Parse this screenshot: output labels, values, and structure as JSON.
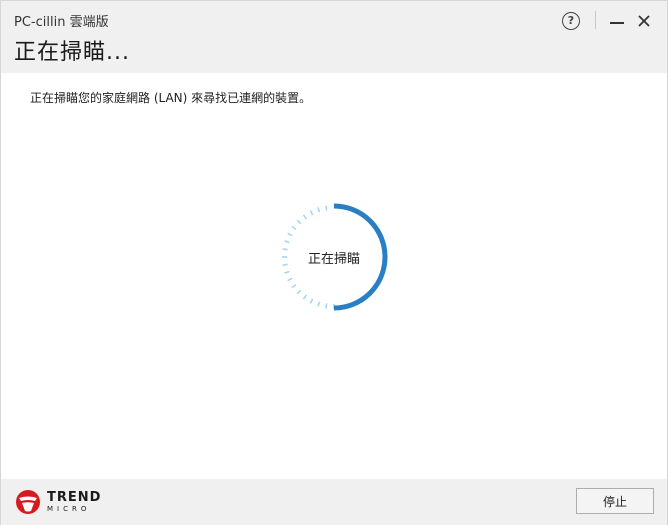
{
  "window": {
    "app_title": "PC-cillin 雲端版",
    "page_title": "正在掃瞄..."
  },
  "header_buttons": {
    "help_symbol": "?",
    "help_icon": "help-circle-icon",
    "minimize_icon": "minimize-icon",
    "close_icon": "close-icon",
    "close_symbol": "✕"
  },
  "main": {
    "description": "正在掃瞄您的家庭網路 (LAN) 來尋找已連網的裝置。",
    "spinner_label": "正在掃瞄",
    "progress_fraction": 0.5
  },
  "footer": {
    "logo_main": "TREND",
    "logo_sub": "MICRO",
    "stop_label": "停止"
  },
  "colors": {
    "header_bg": "#f0f0f0",
    "accent_blue": "#2a7fc4",
    "track_light_blue": "#a9d4f2",
    "logo_red": "#d71920"
  }
}
